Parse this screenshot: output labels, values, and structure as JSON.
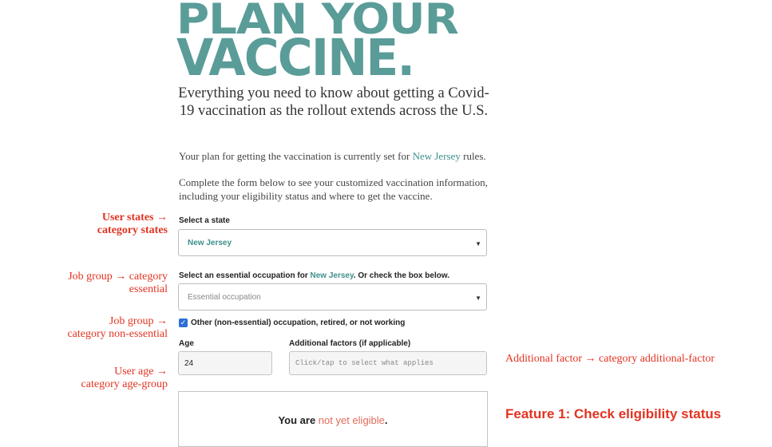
{
  "hero": {
    "line1": "PLAN YOUR",
    "line2": "VACCINE."
  },
  "subtitle": "Everything you need to know about getting a Covid-19 vaccination as the rollout extends across the U.S.",
  "plan": {
    "prefix": "Your plan for getting the vaccination is currently set for ",
    "state": "New Jersey",
    "suffix": " rules."
  },
  "intro": "Complete the form below to see your customized vaccination information, including your eligibility status and where to get the vaccine.",
  "state_select": {
    "label": "Select a state",
    "value": "New Jersey",
    "value_color": "#3e8f8b"
  },
  "occupation_select": {
    "label_prefix": "Select an essential occupation for ",
    "label_state": "New Jersey",
    "label_suffix": ". Or check the box below.",
    "placeholder": "Essential occupation"
  },
  "other_checkbox": {
    "checked": true,
    "label": "Other (non-essential) occupation, retired, or not working"
  },
  "age": {
    "label": "Age",
    "value": "24"
  },
  "factors": {
    "label": "Additional factors (if applicable)",
    "placeholder": "Click/tap to select what applies"
  },
  "result": {
    "prefix": "You are ",
    "status": "not yet eligible",
    "suffix": "."
  },
  "annotations": {
    "user_states_1": "User states →",
    "user_states_2": "category states",
    "job_essential_1": "Job group → category",
    "job_essential_2": "essential",
    "job_nonessential_1": "Job group →",
    "job_nonessential_2": "category non-essential",
    "user_age_1": "User age →",
    "user_age_2": "category age-group",
    "additional_factor": "Additional factor → category additional-factor",
    "feature_1": "Feature 1: Check eligibility status"
  },
  "colors": {
    "brand_teal": "#5a9c98",
    "annotation_red": "#e33321",
    "status_red": "#e06b5a",
    "checkbox_blue": "#2d6fd6"
  }
}
